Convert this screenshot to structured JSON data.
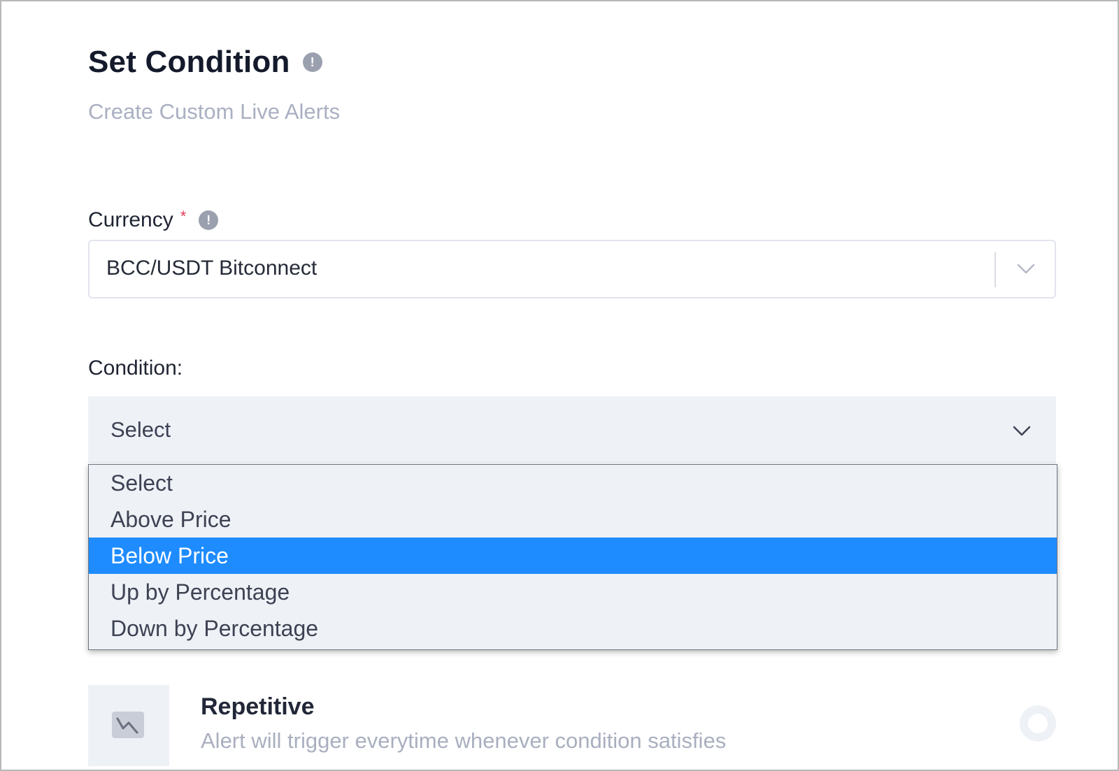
{
  "header": {
    "title": "Set Condition",
    "subtitle": "Create Custom Live Alerts"
  },
  "currency": {
    "label": "Currency",
    "required_mark": "*",
    "value": "BCC/USDT Bitconnect"
  },
  "condition": {
    "label": "Condition:",
    "value": "Select",
    "options": [
      "Select",
      "Above Price",
      "Below Price",
      "Up by Percentage",
      "Down by Percentage"
    ],
    "highlighted": "Below Price"
  },
  "repetitive": {
    "title": "Repetitive",
    "description": "Alert will trigger everytime whenever condition satisfies"
  },
  "icons": {
    "title_info": "info-icon",
    "currency_info": "info-icon",
    "currency_chevron": "chevron-down-icon",
    "condition_chevron": "chevron-down-icon",
    "repetitive": "trend-down-icon"
  },
  "colors": {
    "highlight": "#1e8cff",
    "required": "#e53a5a"
  }
}
